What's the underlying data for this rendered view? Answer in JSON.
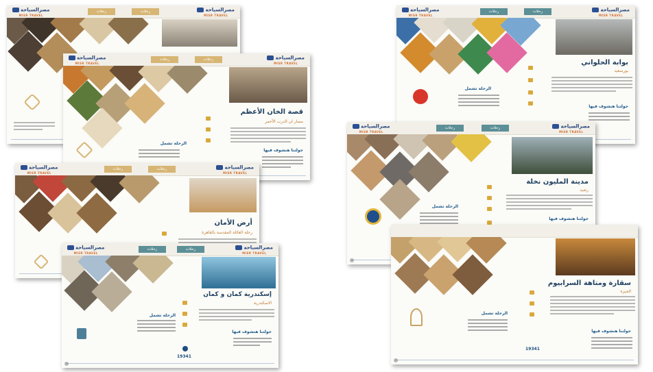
{
  "brand": {
    "arabic": "مصرالسياحة",
    "latin": "MISR TRAVEL"
  },
  "nav": {
    "label": "رحلات"
  },
  "sheets": [
    {
      "id": "s1",
      "title": "",
      "subtitle": ""
    },
    {
      "id": "s2",
      "title": "قصة الخان الأعظم",
      "subtitle": "مسار ان الدرب الأحمر",
      "section_includes": "الرحلة تشمل",
      "section_tour": "جولتنا هنشوف فيها"
    },
    {
      "id": "s3",
      "title": "أرض الأمان",
      "subtitle": "رحلة العائلة المقدسة بالقاهرة",
      "section_includes": "الرحلة تشمل",
      "section_tour": "جولتنا هنشوف فيها"
    },
    {
      "id": "s4",
      "title": "إسكندرية كمان و كمان",
      "subtitle": "الاسكندرية",
      "section_includes": "الرحلة تشمل",
      "section_tour": "جولتنا هنشوف فيها",
      "hotline": "19341"
    },
    {
      "id": "s5",
      "title": "بوابة الحلواني",
      "subtitle": "بورسعيد",
      "section_includes": "الرحلة تشمل",
      "section_tour": "جولتنا هنشوف فيها"
    },
    {
      "id": "s6",
      "title": "مدينة المليون نخلة",
      "subtitle": "رشيد",
      "section_includes": "الرحلة تشمل",
      "section_tour": "جولتنا هنشوف فيها",
      "hotline": "19341"
    },
    {
      "id": "s7",
      "title": "سقارة ومتاهة السرابيوم",
      "subtitle": "الجيزة",
      "section_includes": "الرحلة تشمل",
      "section_tour": "جولتنا هنشوف فيها",
      "hotline": "19341"
    }
  ],
  "colors": {
    "gold": "#d7b574",
    "teal": "#5c8f96",
    "navy": "#20415f",
    "accent": "#c37a2c"
  }
}
